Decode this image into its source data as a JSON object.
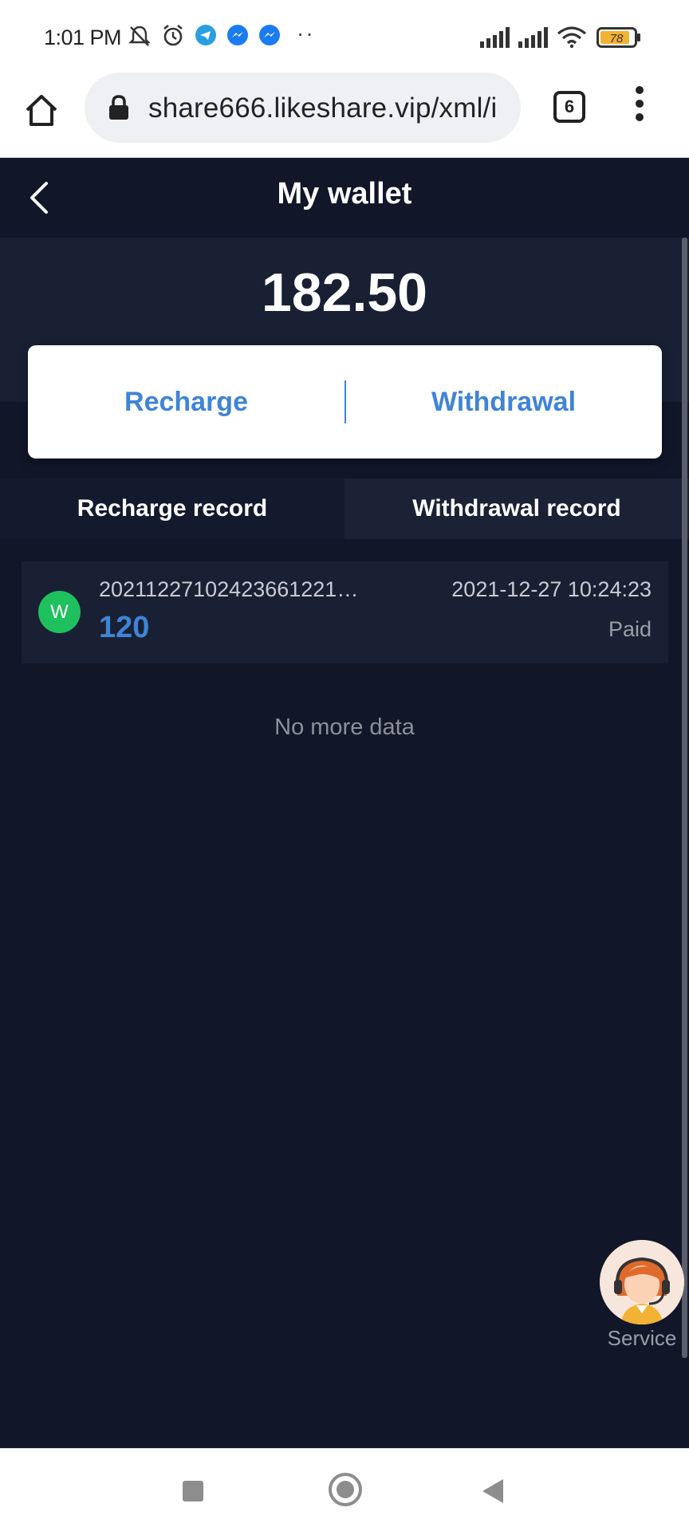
{
  "status_bar": {
    "time": "1:01 PM",
    "battery": "78",
    "icons": [
      "mute-bell-icon",
      "alarm-icon",
      "telegram-icon",
      "messenger-icon",
      "messenger-icon",
      "more-notifications-icon",
      "signal-icon",
      "signal-icon",
      "wifi-icon",
      "battery-icon"
    ],
    "more_dots": "··"
  },
  "browser": {
    "url": "share666.likeshare.vip/xml/i",
    "tab_count": "6",
    "icons": [
      "home-icon",
      "lock-icon",
      "tabs-icon",
      "menu-dots-icon"
    ]
  },
  "header": {
    "title": "My wallet",
    "back_icon": "chevron-left-icon"
  },
  "wallet": {
    "balance": "182.50",
    "recharge_label": "Recharge",
    "withdraw_label": "Withdrawal"
  },
  "record_tabs": [
    {
      "label": "Recharge record"
    },
    {
      "label": "Withdrawal record"
    }
  ],
  "records": [
    {
      "avatar": "W",
      "id": "20211227102423661221…",
      "amount": "120",
      "datetime": "2021-12-27 10:24:23",
      "status": "Paid"
    }
  ],
  "list_footer": "No more data",
  "service": {
    "label": "Service",
    "icon": "support-agent-icon"
  },
  "colors": {
    "background": "#111629",
    "panel": "#1a2034",
    "accent": "#3f84d6",
    "avatar_green": "#1ec15d"
  },
  "nav_bar": {
    "icons": [
      "recent-apps-icon",
      "home-circle-icon",
      "back-triangle-icon"
    ]
  }
}
